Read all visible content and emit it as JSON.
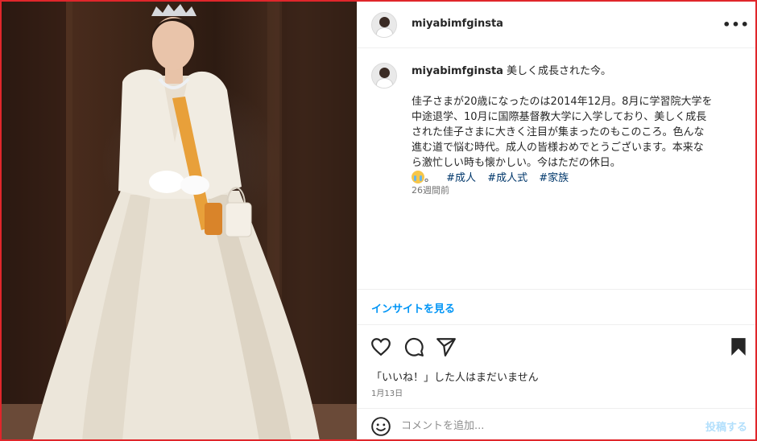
{
  "post": {
    "username": "miyabimfginsta",
    "caption": {
      "title": "美しく成長された今。",
      "lines": [
        "佳子さまが20歳になったのは2014年12月。8月に学習院大学を",
        "中途退学、10月に国際基督教大学に入学しており、美しく成長",
        "された佳子さまに大きく注目が集まったのもこのころ。色んな",
        "進む道で悩む時代。成人の皆様おめでとうございます。本来な",
        "ら激忙しい時も懐かしい。今はただの休日。"
      ],
      "emoji_trail": "。",
      "hashtags": [
        "#成人",
        "#成人式",
        "#家族"
      ],
      "time_ago": "26週間前"
    },
    "insights_link": "インサイトを見る",
    "likes_text": "「いいね！」した人はまだいません",
    "date": "1月13日",
    "comment_placeholder": "コメントを追加...",
    "post_button": "投稿する"
  },
  "icons": {
    "more": "more-icon",
    "like": "heart-icon",
    "comment": "comment-icon",
    "share": "share-icon",
    "save": "bookmark-icon",
    "emoji": "smile-icon",
    "caption_emoji": "crying-face-icon"
  },
  "colors": {
    "frame": "#e0262b",
    "link": "#0095f6",
    "hashtag": "#00376b",
    "muted": "#737373",
    "post_disabled": "#b2dffc"
  }
}
